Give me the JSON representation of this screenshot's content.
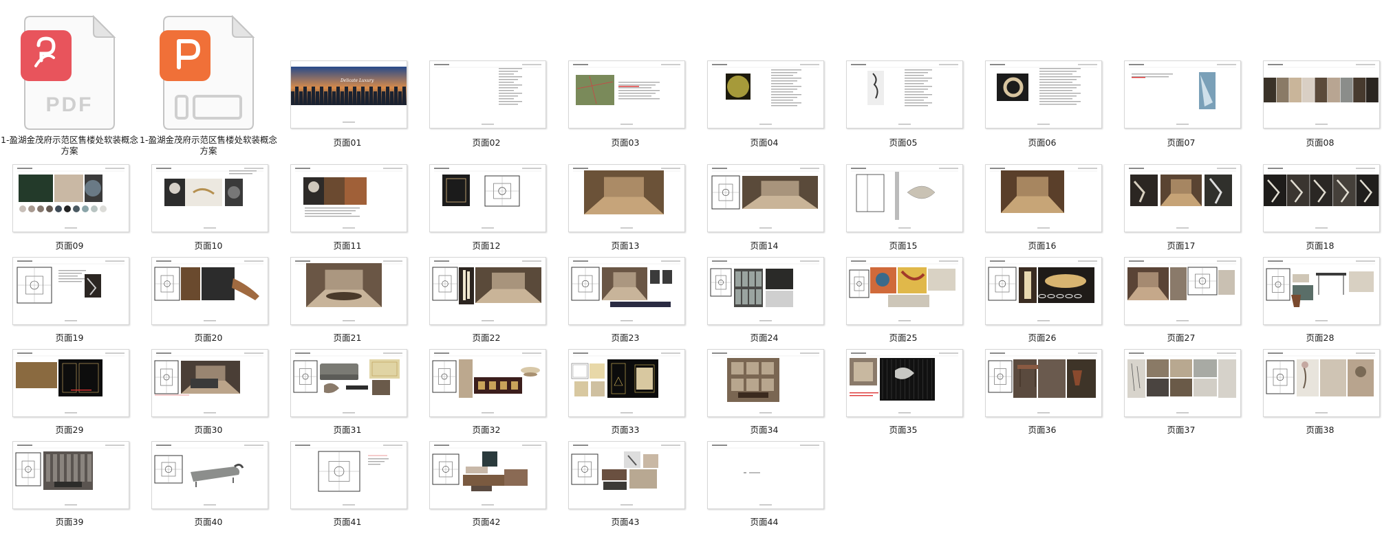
{
  "files": [
    {
      "name": "1-盈湖金茂府示范区售楼处软装概念方案",
      "type": "PDF",
      "icon": "pdf-file-icon",
      "badge_color": "#e8545c",
      "badge_text": "PDF"
    },
    {
      "name": "1-盈湖金茂府示范区售楼处软装概念方案",
      "type": "PPT",
      "icon": "presentation-file-icon",
      "badge_color": "#f07038",
      "badge_text": ""
    }
  ],
  "pages": [
    {
      "label": "页面01",
      "kind": "cover"
    },
    {
      "label": "页面02",
      "kind": "text"
    },
    {
      "label": "页面03",
      "kind": "map"
    },
    {
      "label": "页面04",
      "kind": "moon"
    },
    {
      "label": "页面05",
      "kind": "sculpture"
    },
    {
      "label": "页面06",
      "kind": "ring"
    },
    {
      "label": "页面07",
      "kind": "glass"
    },
    {
      "label": "页面08",
      "kind": "strip"
    },
    {
      "label": "页面09",
      "kind": "palette"
    },
    {
      "label": "页面10",
      "kind": "portrait"
    },
    {
      "label": "页面11",
      "kind": "portrait2"
    },
    {
      "label": "页面12",
      "kind": "plan2"
    },
    {
      "label": "页面13",
      "kind": "lobby"
    },
    {
      "label": "页面14",
      "kind": "plan-interior"
    },
    {
      "label": "页面15",
      "kind": "elevation"
    },
    {
      "label": "页面16",
      "kind": "lobby2"
    },
    {
      "label": "页面17",
      "kind": "chandelier"
    },
    {
      "label": "页面18",
      "kind": "chandelier2"
    },
    {
      "label": "页面19",
      "kind": "plan-small"
    },
    {
      "label": "页面20",
      "kind": "plan-wood"
    },
    {
      "label": "页面21",
      "kind": "dining"
    },
    {
      "label": "页面22",
      "kind": "plan-light"
    },
    {
      "label": "页面23",
      "kind": "plan-dining"
    },
    {
      "label": "页面24",
      "kind": "plan-shop"
    },
    {
      "label": "页面25",
      "kind": "plan-art"
    },
    {
      "label": "页面26",
      "kind": "plan-lamp"
    },
    {
      "label": "页面27",
      "kind": "living"
    },
    {
      "label": "页面28",
      "kind": "plan-furn"
    },
    {
      "label": "页面29",
      "kind": "cad-dark"
    },
    {
      "label": "页面30",
      "kind": "plan-office"
    },
    {
      "label": "页面31",
      "kind": "plan-sofa"
    },
    {
      "label": "页面32",
      "kind": "plan-cabinet"
    },
    {
      "label": "页面33",
      "kind": "cad-gold"
    },
    {
      "label": "页面34",
      "kind": "library"
    },
    {
      "label": "页面35",
      "kind": "cad-grid"
    },
    {
      "label": "页面36",
      "kind": "plan-desk"
    },
    {
      "label": "页面37",
      "kind": "photos"
    },
    {
      "label": "页面38",
      "kind": "plan-flower"
    },
    {
      "label": "页面39",
      "kind": "plan-wall"
    },
    {
      "label": "页面40",
      "kind": "plan-chaise"
    },
    {
      "label": "页面41",
      "kind": "plan-empty"
    },
    {
      "label": "页面42",
      "kind": "plan-collage"
    },
    {
      "label": "页面43",
      "kind": "plan-collage2"
    },
    {
      "label": "页面44",
      "kind": "end"
    }
  ]
}
